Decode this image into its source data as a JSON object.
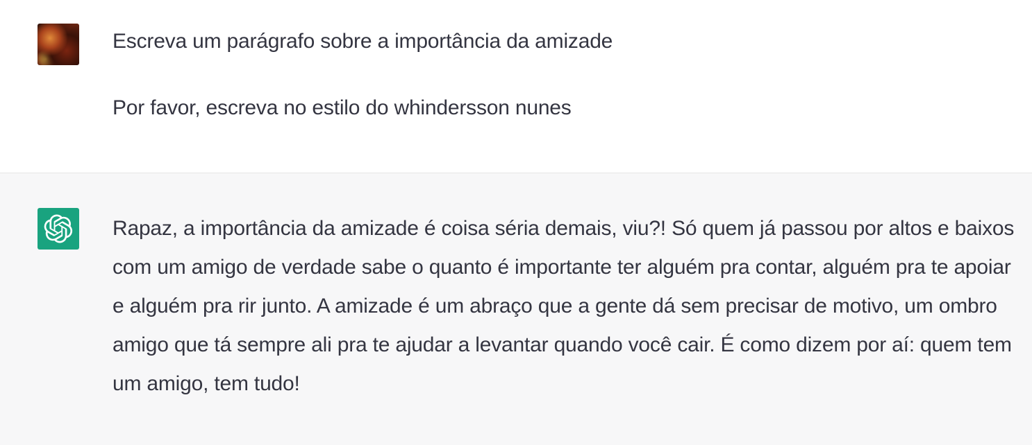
{
  "conversation": {
    "user_message": {
      "avatar": "user-avatar-photo",
      "paragraphs": [
        "Escreva um parágrafo sobre a importância da amizade",
        "Por favor, escreva no estilo do whindersson nunes"
      ]
    },
    "assistant_message": {
      "avatar": "openai-logo-icon",
      "avatar_color": "#19a37f",
      "text": "Rapaz, a importância da amizade é coisa séria demais, viu?! Só quem já passou por altos e baixos com um amigo de verdade sabe o quanto é importante ter alguém pra contar, alguém pra te apoiar e alguém pra rir junto. A amizade é um abraço que a gente dá sem precisar de motivo, um ombro amigo que tá sempre ali pra te ajudar a levantar quando você cair. É como dizem por aí: quem tem um amigo, tem tudo!"
    }
  },
  "colors": {
    "text": "#343541",
    "assistant_bg": "#f7f7f8",
    "user_bg": "#ffffff",
    "divider": "#e5e5e5"
  }
}
